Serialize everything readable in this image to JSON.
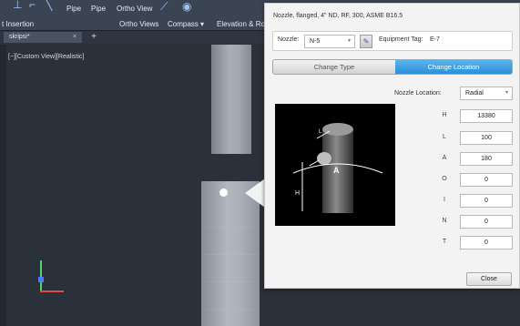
{
  "ribbon": {
    "items": [
      "Pipe",
      "Pipe",
      "Ortho View",
      "Ortho Views",
      "Compass",
      "Elevation & Ro"
    ],
    "panel_label": "t Insertion"
  },
  "tabs": {
    "drawing_tab": "skripsi*"
  },
  "viewport": {
    "view_label": "[−][Custom View][Realistic]"
  },
  "dialog": {
    "title": "Nozzle, flanged, 4\" ND, RF, 300, ASME B16.5",
    "nozzle_label": "Nozzle:",
    "nozzle_value": "N-5",
    "equipment_tag_label": "Equipment Tag:",
    "equipment_tag_value": "E-7",
    "change_type_label": "Change Type",
    "change_location_label": "Change Location",
    "nozzle_location_label": "Nozzle Location:",
    "nozzle_location_value": "Radial",
    "fields": [
      {
        "label": "H",
        "value": "13380"
      },
      {
        "label": "L",
        "value": "100"
      },
      {
        "label": "A",
        "value": "180"
      },
      {
        "label": "O",
        "value": "0"
      },
      {
        "label": "I",
        "value": "0"
      },
      {
        "label": "N",
        "value": "0"
      },
      {
        "label": "T",
        "value": "0"
      }
    ],
    "close_label": "Close"
  }
}
